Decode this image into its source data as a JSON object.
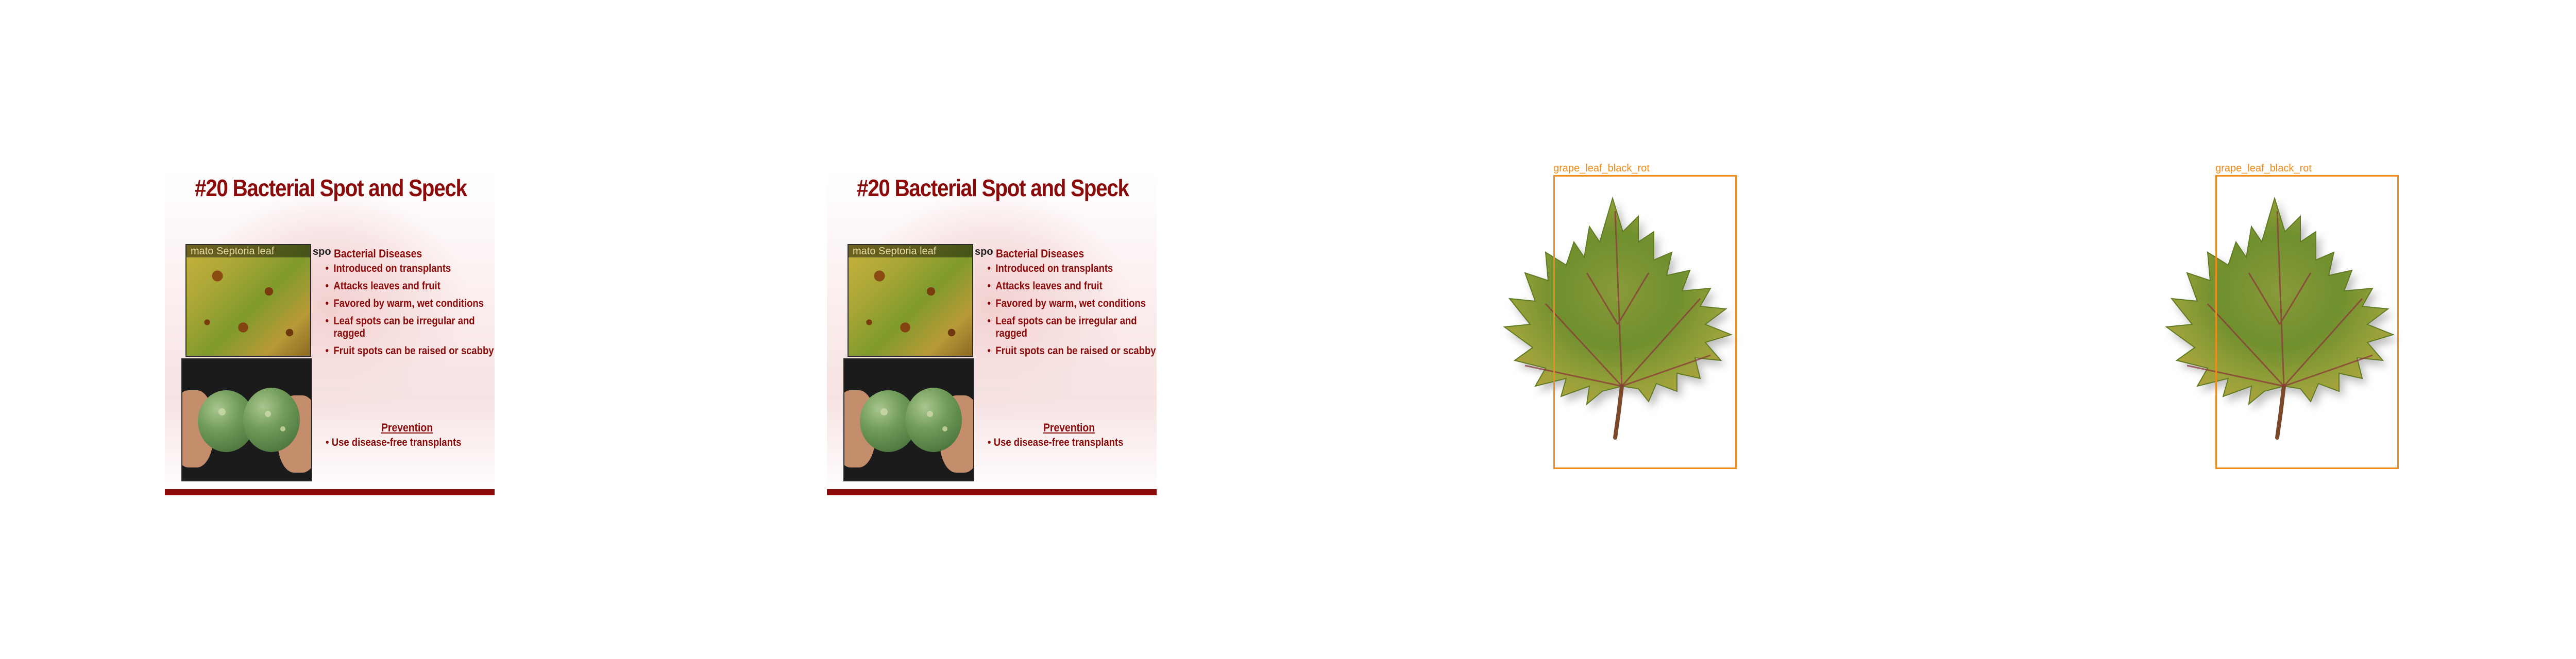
{
  "slides": [
    {
      "title": "#20 Bacterial Spot and Speck",
      "photo_caption": "mato Septoria leaf",
      "side_label": "spo",
      "heading": "Bacterial Diseases",
      "bullets": [
        "Introduced on transplants",
        "Attacks leaves and fruit",
        "Favored by warm, wet conditions",
        "Leaf spots can be irregular and ragged",
        "Fruit spots can be raised or scabby"
      ],
      "prevention_heading": "Prevention",
      "prevention_item": "Use disease-free transplants",
      "colors": {
        "title": "#8b0a0a",
        "bar": "#8b0a0a"
      }
    },
    {
      "title": "#20 Bacterial Spot and Speck",
      "photo_caption": "mato Septoria leaf",
      "side_label": "spo",
      "heading": "Bacterial Diseases",
      "bullets": [
        "Introduced on transplants",
        "Attacks leaves and fruit",
        "Favored by warm, wet conditions",
        "Leaf spots can be irregular and ragged",
        "Fruit spots can be raised or scabby"
      ],
      "prevention_heading": "Prevention",
      "prevention_item": "Use disease-free transplants",
      "colors": {
        "title": "#8b0a0a",
        "bar": "#8b0a0a"
      }
    }
  ],
  "detections": [
    {
      "label": "grape_leaf_black_rot",
      "box_color": "#f08c1a"
    },
    {
      "label": "grape_leaf_black_rot",
      "box_color": "#f08c1a"
    }
  ]
}
